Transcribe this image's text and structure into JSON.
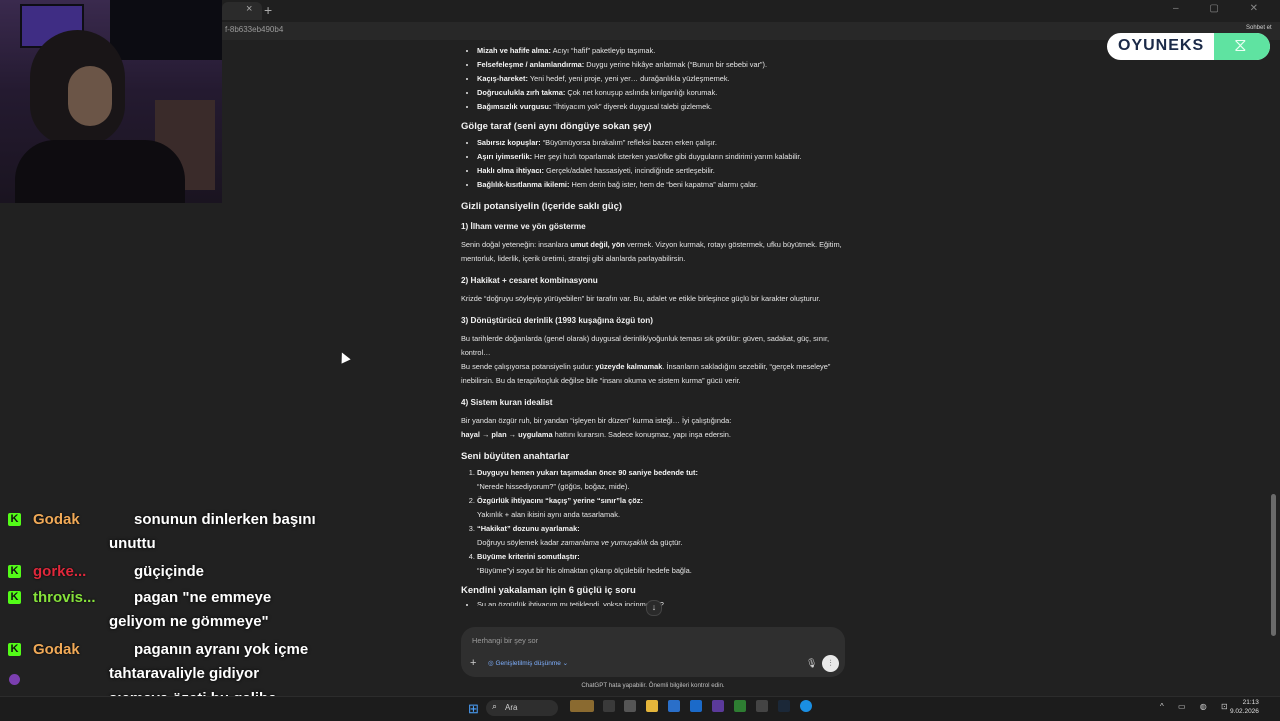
{
  "browser": {
    "tab_close": "×",
    "new_tab": "+",
    "url": "f-8b633eb490b4",
    "share_label": "Sohbet et",
    "window_controls": "–  ▢  ✕"
  },
  "chat_content": {
    "bullets_top": [
      {
        "bold": "Mizah ve hafife alma:",
        "text": " Acıyı “hafif” paketleyip taşımak."
      },
      {
        "bold": "Felsefeleşme / anlamlandırma:",
        "text": " Duygu yerine hikâye anlatmak (“Bunun bir sebebi var”)."
      },
      {
        "bold": "Kaçış-hareket:",
        "text": " Yeni hedef, yeni proje, yeni yer… durağanlıkla yüzleşmemek."
      },
      {
        "bold": "Doğruculukla zırh takma:",
        "text": " Çok net konuşup aslında kırılganlığı korumak."
      },
      {
        "bold": "Bağımsızlık vurgusu:",
        "text": " “İhtiyacım yok” diyerek duygusal talebi gizlemek."
      }
    ],
    "shadow_title": "Gölge taraf (seni aynı döngüye sokan şey)",
    "shadow_bullets": [
      {
        "bold": "Sabırsız kopuşlar:",
        "text": " “Büyümüyorsa bırakalım” refleksi bazen erken çalışır."
      },
      {
        "bold": "Aşırı iyimserlik:",
        "text": " Her şeyi hızlı toparlamak isterken yas/öfke gibi duyguların sindirimi yarım kalabilir."
      },
      {
        "bold": "Haklı olma ihtiyacı:",
        "text": " Gerçek/adalet hassasiyeti, incindiğinde sertleşebilir."
      },
      {
        "bold": "Bağlılık-kısıtlanma ikilemi:",
        "text": " Hem derin bağ ister, hem de “beni kapatma” alarmı çalar."
      }
    ],
    "potential_title": "Gizli potansiyelin (içeride saklı güç)",
    "p1_title": "1) İlham verme ve yön gösterme",
    "p1_pre": "Senin doğal yeteneğin: insanlara ",
    "p1_bold": "umut değil, yön",
    "p1_post": " vermek. Vizyon kurmak, rotayı göstermek, ufku büyütmek. Eğitim, mentorluk, liderlik, içerik üretimi, strateji gibi alanlarda parlayabilirsin.",
    "p2_title": "2) Hakikat + cesaret kombinasyonu",
    "p2_text": "Krizde “doğruyu söyleyip yürüyebilen” bir tarafın var. Bu, adalet ve etikle birleşince güçlü bir karakter oluşturur.",
    "p3_title": "3) Dönüştürücü derinlik (1993 kuşağına özgü ton)",
    "p3_text1": "Bu tarihlerde doğanlarda (genel olarak) duygusal derinlik/yoğunluk teması sık görülür: güven, sadakat, güç, sınır, kontrol…",
    "p3_pre": "Bu sende çalışıyorsa potansiyelin şudur: ",
    "p3_bold": "yüzeyde kalmamak",
    "p3_post": ". İnsanların sakladığını sezebilir, “gerçek meseleye” inebilirsin. Bu da terapi/koçluk değilse bile “insanı okuma ve sistem kurma” gücü verir.",
    "p4_title": "4) Sistem kuran idealist",
    "p4_text1": "Bir yandan özgür ruh, bir yandan “işleyen bir düzen” kurma isteği… İyi çalıştığında:",
    "p4_bold": "hayal → plan → uygulama",
    "p4_post": " hattını kurarsın. Sadece konuşmaz, yapı inşa edersin.",
    "keys_title": "Seni büyüten anahtarlar",
    "keys": [
      {
        "bold": "Duyguyu hemen yukarı taşımadan önce 90 saniye bedende tut:",
        "text": "“Nerede hissediyorum?” (göğüs, boğaz, mide)."
      },
      {
        "bold": "Özgürlük ihtiyacını “kaçış” yerine “sınır”la çöz:",
        "text": "Yakınlık + alan ikisini aynı anda tasarlamak."
      },
      {
        "bold": "“Hakikat” dozunu ayarlamak:",
        "text_pre": "Doğruyu söylemek kadar ",
        "text_em": "zamanlama ve yumuşaklık",
        "text_post": " da güçtür."
      },
      {
        "bold": "Büyüme kriterini somutlaştır:",
        "text": "“Büyüme”yi soyut bir his olmaktan çıkarıp ölçülebilir hedefe bağla."
      }
    ],
    "questions_title": "Kendini yakalaman için 6 güçlü iç soru",
    "questions_first": "Şu an özgürlük ihtiyacım mı tetiklendi, yoksa incinme mi?",
    "bunun_bir_sebebi_var": "Bunun bir sebebi var"
  },
  "composer": {
    "placeholder": "Herhangi bir şey sor",
    "plus": "+",
    "think_label": "Genişletilmiş düşünme",
    "mic": "🎙",
    "voice": "⫶",
    "scroll_down": "↓"
  },
  "disclaimer": "ChatGPT hata yapabilir. Önemli bilgileri kontrol edin.",
  "overlay": {
    "brand": "OYUNEKS",
    "brand_icon": "dna-icon"
  },
  "stream_chat": [
    {
      "user": "Godak",
      "color": "#f0a957",
      "message": "sonunun dinlerken başını",
      "continuation": "unuttu"
    },
    {
      "user": "gorke...",
      "color": "#e0283b",
      "message": "güçiçinde"
    },
    {
      "user": "throvis...",
      "color": "#86e23b",
      "message": "pagan \"ne emmeye",
      "continuation": "geliyom ne gömmeye\""
    },
    {
      "user": "Godak",
      "color": "#f0a957",
      "message": "paganın ayranı yok içme",
      "continuation": "tahtaravaliyle gidiyor",
      "continuation2": "sıçmaya özeti bu galiba"
    }
  ],
  "taskbar": {
    "start_icon": "windows-icon",
    "search_placeholder": "Ara",
    "time": "21:13",
    "date": "9.02.2026",
    "tray": "^ ▭ ◍ ⊡"
  }
}
